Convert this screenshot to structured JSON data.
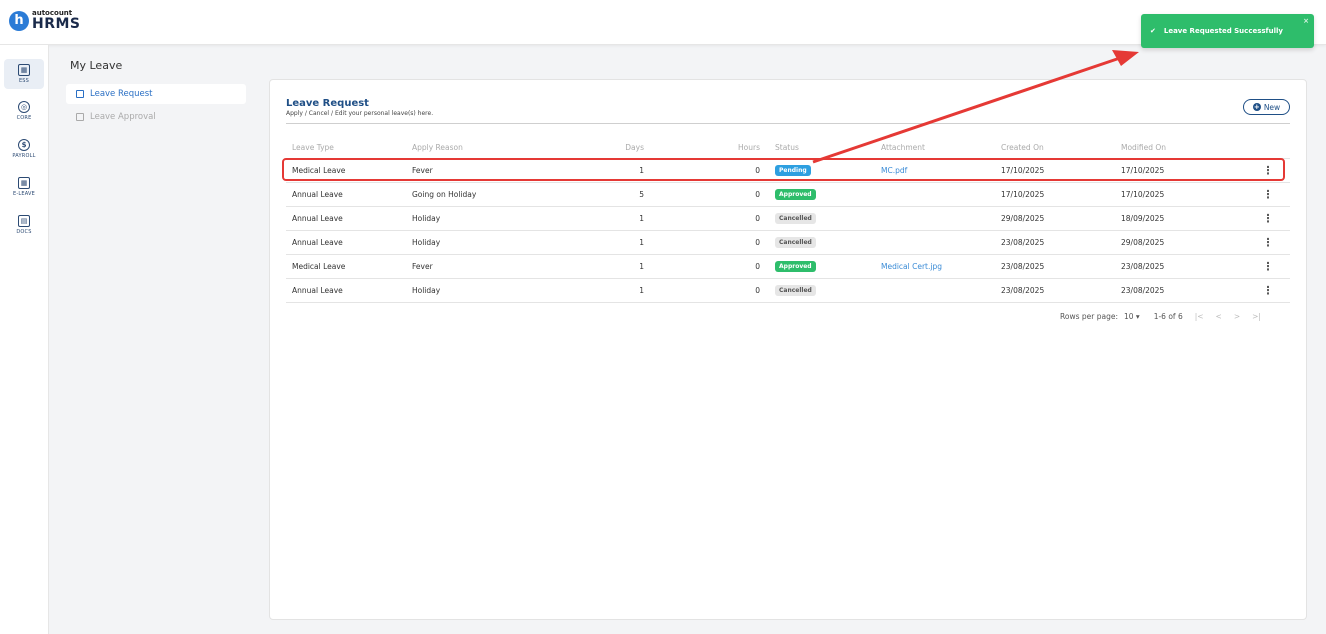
{
  "app": {
    "logo_letter": "h",
    "logo_small": "autocount",
    "logo_big": "HRMS"
  },
  "sidebar": {
    "items": [
      {
        "label": "ESS",
        "icon": "ess-icon",
        "glyph": "▦"
      },
      {
        "label": "CORE",
        "icon": "core-icon",
        "glyph": "◎"
      },
      {
        "label": "PAYROLL",
        "icon": "payroll-icon",
        "glyph": "$"
      },
      {
        "label": "E-LEAVE",
        "icon": "calendar-icon",
        "glyph": "▦"
      },
      {
        "label": "DOCS",
        "icon": "docs-icon",
        "glyph": "▤"
      }
    ]
  },
  "page": {
    "title": "My Leave"
  },
  "leftnav": {
    "items": [
      {
        "label": "Leave Request",
        "active": true
      },
      {
        "label": "Leave Approval",
        "active": false
      }
    ]
  },
  "card": {
    "title": "Leave Request",
    "subtitle": "Apply / Cancel / Edit your personal leave(s) here.",
    "new_label": "New"
  },
  "table": {
    "headers": [
      "Leave Type",
      "Apply Reason",
      "Days",
      "Hours",
      "Status",
      "Attachment",
      "Created On",
      "Modified On"
    ],
    "rows": [
      {
        "type": "Medical Leave",
        "reason": "Fever",
        "days": "1",
        "hours": "0",
        "status": "Pending",
        "attachment": "MC.pdf",
        "created": "17/10/2025",
        "modified": "17/10/2025"
      },
      {
        "type": "Annual Leave",
        "reason": "Going on Holiday",
        "days": "5",
        "hours": "0",
        "status": "Approved",
        "attachment": "",
        "created": "17/10/2025",
        "modified": "17/10/2025"
      },
      {
        "type": "Annual Leave",
        "reason": "Holiday",
        "days": "1",
        "hours": "0",
        "status": "Cancelled",
        "attachment": "",
        "created": "29/08/2025",
        "modified": "18/09/2025"
      },
      {
        "type": "Annual Leave",
        "reason": "Holiday",
        "days": "1",
        "hours": "0",
        "status": "Cancelled",
        "attachment": "",
        "created": "23/08/2025",
        "modified": "29/08/2025"
      },
      {
        "type": "Medical Leave",
        "reason": "Fever",
        "days": "1",
        "hours": "0",
        "status": "Approved",
        "attachment": "Medical Cert.jpg",
        "created": "23/08/2025",
        "modified": "23/08/2025"
      },
      {
        "type": "Annual Leave",
        "reason": "Holiday",
        "days": "1",
        "hours": "0",
        "status": "Cancelled",
        "attachment": "",
        "created": "23/08/2025",
        "modified": "23/08/2025"
      }
    ]
  },
  "pager": {
    "rows_label": "Rows per page:",
    "rows_value": "10",
    "range": "1-6 of 6"
  },
  "toast": {
    "message": "Leave Requested Successfully",
    "close": "×"
  },
  "colors": {
    "brand": "#1f4f86",
    "success": "#2ebd6b",
    "pending": "#2d9fe0",
    "annotation": "#e53935"
  }
}
